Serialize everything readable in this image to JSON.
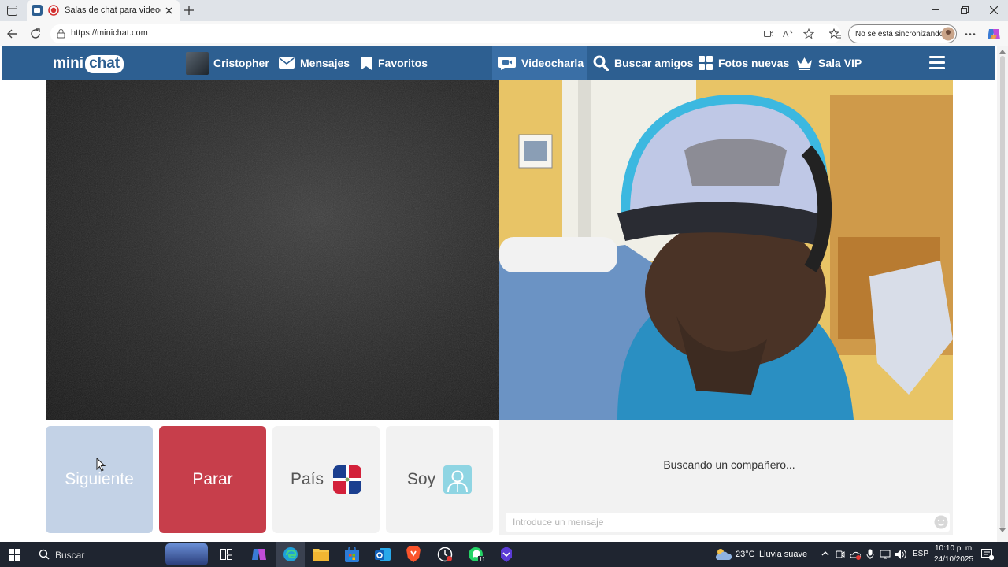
{
  "browser": {
    "tab_title": "Salas de chat para videocitas",
    "url": "https://minichat.com",
    "sync_label": "No se está sincronizando"
  },
  "site": {
    "logo_left": "mini",
    "logo_right": "chat",
    "nav": {
      "user": "Cristopher",
      "messages": "Mensajes",
      "favorites": "Favoritos",
      "videochat": "Videocharla",
      "search_friends": "Buscar amigos",
      "new_photos": "Fotos nuevas",
      "vip": "Sala VIP"
    }
  },
  "controls": {
    "next": "Siguiente",
    "stop": "Parar",
    "country": "País",
    "gender": "Soy"
  },
  "chat": {
    "status": "Buscando un compañero...",
    "input_placeholder": "Introduce un mensaje"
  },
  "taskbar": {
    "search": "Buscar",
    "weather_temp": "23°C",
    "weather_desc": "Lluvia suave",
    "lang": "ESP",
    "time": "10:10 p. m.",
    "date": "24/10/2025",
    "whatsapp_badge": "11"
  },
  "colors": {
    "nav_bg": "#2d5f91",
    "next_bg": "#c3d2e6",
    "stop_bg": "#c73e4b",
    "neutral_btn": "#f2f2f2"
  }
}
